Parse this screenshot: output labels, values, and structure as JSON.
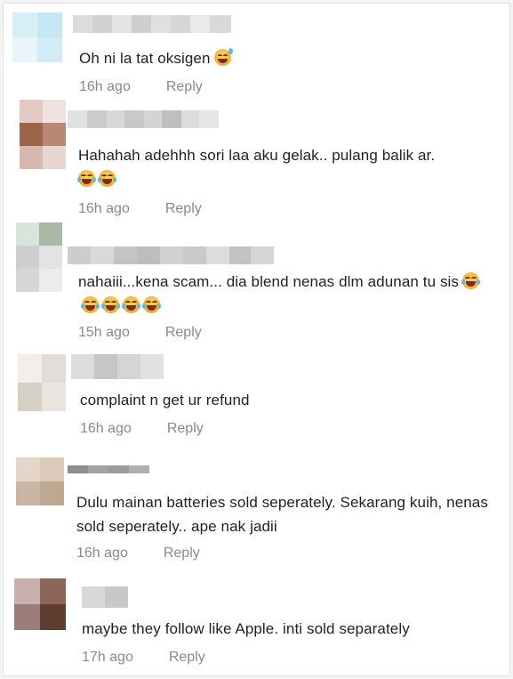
{
  "comments": [
    {
      "text": "Oh ni la tat oksigen",
      "emoji": [
        "sweat-smile-emoji"
      ],
      "time": "16h ago",
      "reply": "Reply",
      "avatar_colors": [
        "#d8eef6",
        "#c6e6f4",
        "#e8f5fa",
        "#d2ecf6"
      ],
      "name_colors": [
        "#dcdcdc",
        "#d0d0d0",
        "#e4e4e4",
        "#cfcfcf",
        "#e0e0e0",
        "#d6d6d6",
        "#eaeaea",
        "#d9d9d9"
      ]
    },
    {
      "text": "Hahahah adehhh sori laa aku gelak.. pulang balik ar.",
      "emoji": [
        "laughing-emoji",
        "laughing-emoji"
      ],
      "time": "16h ago",
      "reply": "Reply",
      "avatar_colors": [
        "#e6c9c4",
        "#f0e2de",
        "#9c6549",
        "#b98774",
        "#d9b7ae",
        "#e8d6d1"
      ],
      "name_colors": [
        "#e2e2e2",
        "#cccccc",
        "#d8d8d8",
        "#c8c8c8",
        "#d4d4d4",
        "#bfbfbf",
        "#dcdcdc",
        "#e6e6e6"
      ]
    },
    {
      "text": "nahaiii...kena scam... dia blend nenas dlm adunan tu sis",
      "emoji": [
        "laughing-emoji",
        "laughing-emoji",
        "laughing-emoji",
        "laughing-emoji",
        "laughing-emoji"
      ],
      "time": "15h ago",
      "reply": "Reply",
      "avatar_colors": [
        "#d9e4dc",
        "#aab9a5",
        "#cfcfcf",
        "#e3e3e3",
        "#d6d6d6",
        "#ececec"
      ],
      "name_colors": [
        "#cdcdcd",
        "#d9d9d9",
        "#c4c4c4",
        "#bdbdbd",
        "#d1d1d1",
        "#c9c9c9",
        "#dcdcdc",
        "#c2c2c2",
        "#d5d5d5"
      ]
    },
    {
      "text": "complaint n get ur refund",
      "emoji": [],
      "time": "16h ago",
      "reply": "Reply",
      "avatar_colors": [
        "#f2efeb",
        "#e2ddd6",
        "#d6cfc4",
        "#e9e5df"
      ],
      "name_colors": [
        "#dcdcdc",
        "#c6c6c6",
        "#d5d5d5",
        "#e2e2e2"
      ]
    },
    {
      "text": "Dulu mainan batteries sold seperately. Sekarang kuih, nenas sold seperately.. ape nak jadii",
      "emoji": [],
      "time": "16h ago",
      "reply": "Reply",
      "avatar_colors": [
        "#e4d6c8",
        "#dccbba",
        "#c9b7a4",
        "#bfa88f"
      ],
      "name_colors": [
        "#8e8e8e",
        "#a3a3a3",
        "#9b9b9b",
        "#b0b0b0"
      ]
    },
    {
      "text": "maybe they follow like Apple. inti sold separately",
      "emoji": [],
      "time": "17h ago",
      "reply": "Reply",
      "avatar_colors": [
        "#c9b0ae",
        "#8b6659",
        "#9a7c78",
        "#5e3d31"
      ],
      "name_colors": [
        "#d8d8d8",
        "#c8c8c8"
      ]
    }
  ]
}
